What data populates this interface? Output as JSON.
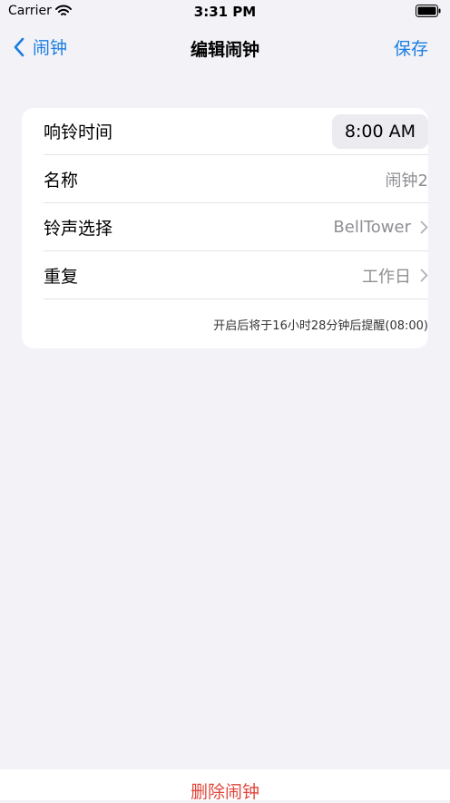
{
  "status_bar": {
    "carrier": "Carrier",
    "time": "3:31 PM"
  },
  "nav": {
    "back_label": "闹钟",
    "title": "编辑闹钟",
    "save_label": "保存"
  },
  "form": {
    "rows": [
      {
        "label": "响铃时间",
        "value": "8:00 AM"
      },
      {
        "label": "名称",
        "value": "闹钟2"
      },
      {
        "label": "铃声选择",
        "value": "BellTower"
      },
      {
        "label": "重复",
        "value": "工作日"
      }
    ],
    "hint": "开启后将于16小时28分钟后提醒(08:00)"
  },
  "bottom": {
    "delete_label": "删除闹钟"
  },
  "colors": {
    "accent": "#1a7de0",
    "destructive": "#e0453a",
    "background": "#f2f2f7"
  },
  "icons": {
    "back": "chevron-left-icon",
    "disclosure": "chevron-right-icon",
    "wifi": "wifi-icon",
    "battery": "battery-icon"
  }
}
